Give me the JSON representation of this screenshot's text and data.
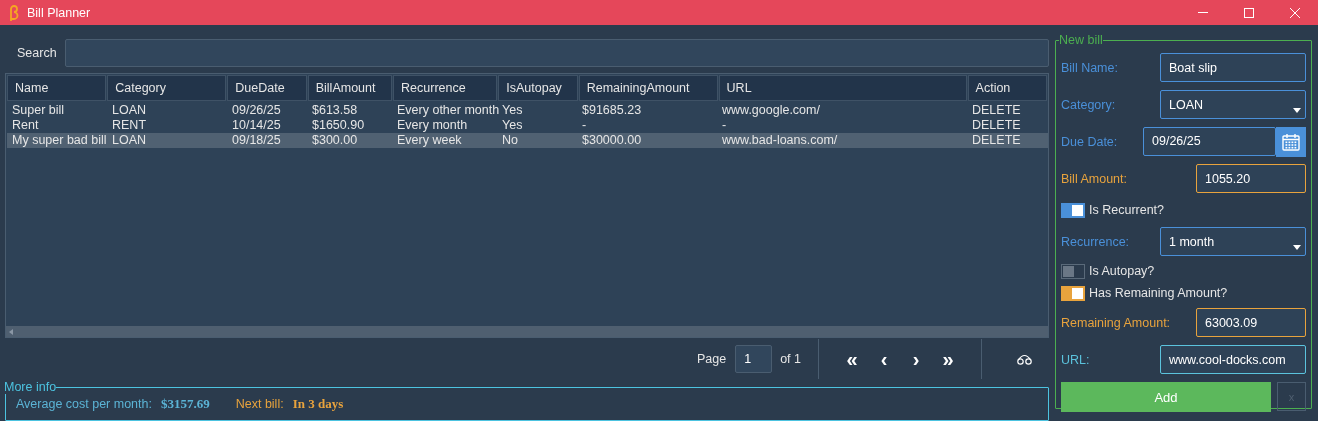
{
  "window": {
    "title": "Bill Planner"
  },
  "search": {
    "label": "Search"
  },
  "table": {
    "columns": [
      "Name",
      "Category",
      "DueDate",
      "BillAmount",
      "Recurrence",
      "IsAutopay",
      "RemainingAmount",
      "URL",
      "Action"
    ],
    "rows": [
      {
        "cells": [
          "Super bill",
          "LOAN",
          "09/26/25",
          "$613.58",
          "Every other month",
          "Yes",
          "$91685.23",
          "www.google.com/",
          "DELETE"
        ],
        "selected": false
      },
      {
        "cells": [
          "Rent",
          "RENT",
          "10/14/25",
          "$1650.90",
          "Every month",
          "Yes",
          "-",
          "-",
          "DELETE"
        ],
        "selected": false
      },
      {
        "cells": [
          "My super bad bill",
          "LOAN",
          "09/18/25",
          "$300.00",
          "Every week",
          "No",
          "$30000.00",
          "www.bad-loans.com/",
          "DELETE"
        ],
        "selected": true
      }
    ]
  },
  "pagination": {
    "label": "Page",
    "page": "1",
    "total": "of 1",
    "buttons": [
      "«",
      "‹",
      "›",
      "»"
    ]
  },
  "more_info": {
    "title": "More info",
    "items": [
      {
        "label": "Average cost per month:",
        "value": "$3157.69",
        "color": "#5bb4d6"
      },
      {
        "label": "Next bill:",
        "value": "In 3 days",
        "color": "#e8a33d"
      }
    ]
  },
  "new_bill": {
    "title": "New bill",
    "rows": [
      {
        "kind": "text",
        "label": "Bill Name:",
        "value": "Boat slip",
        "color": "#4a90d9"
      },
      {
        "kind": "select",
        "label": "Category:",
        "value": "LOAN",
        "color": "#4a90d9"
      },
      {
        "kind": "date",
        "label": "Due Date:",
        "value": "09/26/25",
        "color": "#4a90d9"
      },
      {
        "kind": "amount",
        "label": "Bill Amount:",
        "value": "1055.20",
        "color": "#e8a33d"
      },
      {
        "kind": "toggle",
        "label": "Is Recurrent?",
        "on": true,
        "color": "#4a90d9"
      },
      {
        "kind": "select",
        "label": "Recurrence:",
        "value": "1 month",
        "color": "#4a90d9"
      },
      {
        "kind": "toggle",
        "label": "Is Autopay?",
        "on": false
      },
      {
        "kind": "toggle",
        "label": "Has Remaining Amount?",
        "on": true,
        "color": "#e8a33d"
      },
      {
        "kind": "amount",
        "label": "Remaining Amount:",
        "value": "63003.09",
        "color": "#e8a33d"
      },
      {
        "kind": "text",
        "label": "URL:",
        "value": "www.cool-docks.com",
        "color": "#5bc3dd"
      }
    ],
    "add": "Add",
    "clear": {
      "label": "x",
      "disabled": true
    }
  }
}
